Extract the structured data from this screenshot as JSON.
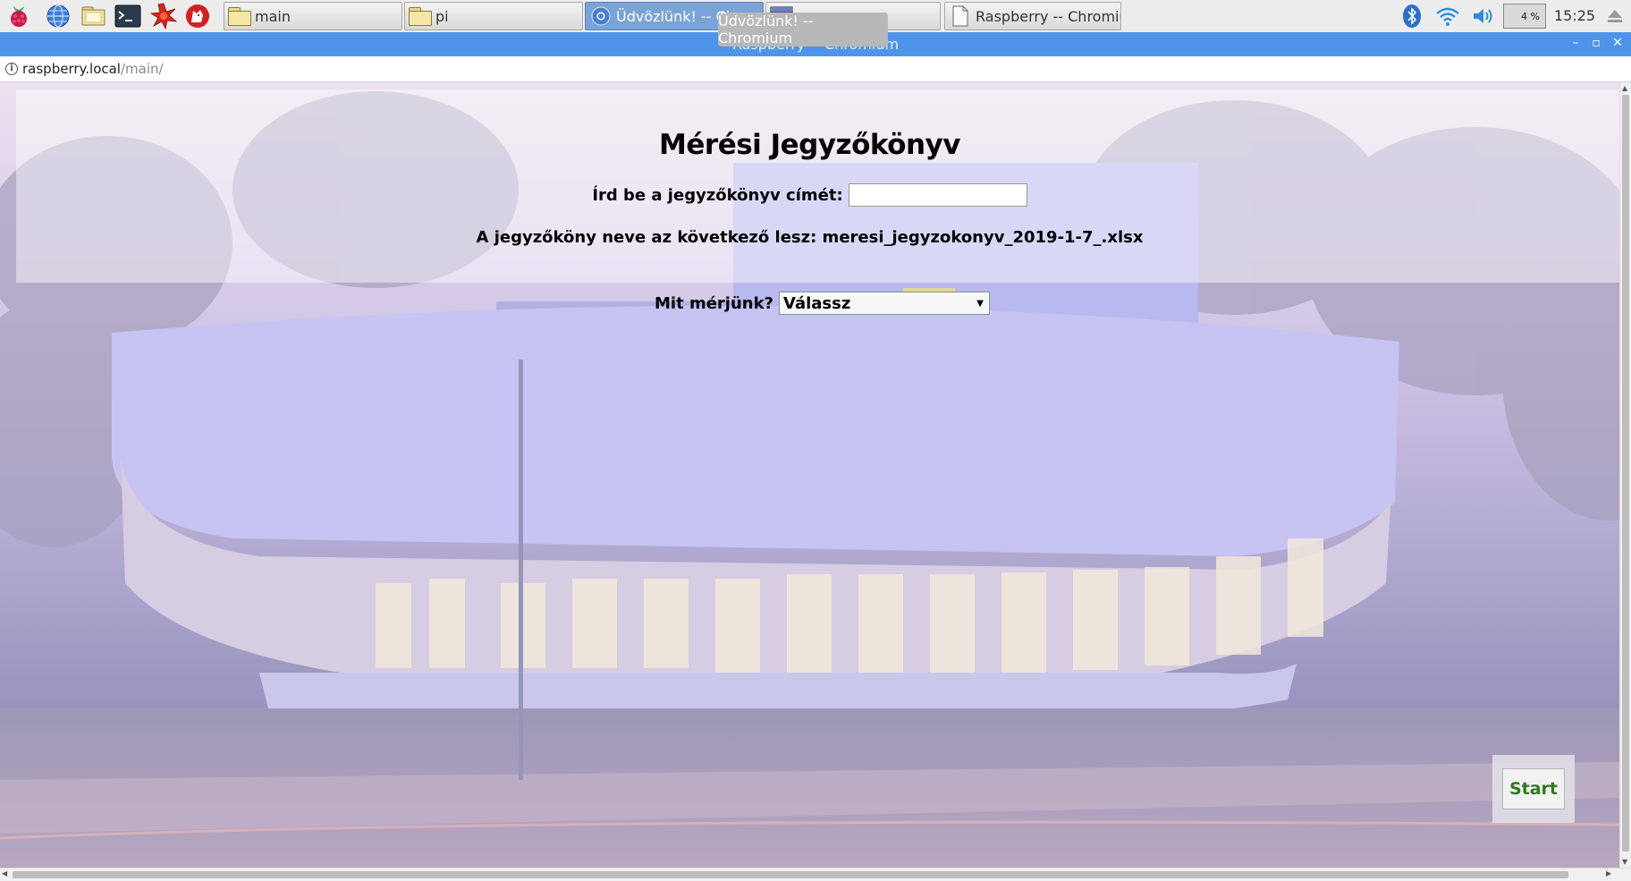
{
  "taskbar": {
    "launchers": [
      {
        "name": "raspberry-menu-icon"
      },
      {
        "name": "web-browser-icon"
      },
      {
        "name": "file-manager-icon"
      },
      {
        "name": "terminal-icon"
      },
      {
        "name": "math-kernel-icon"
      },
      {
        "name": "wolfram-icon"
      }
    ],
    "tasks": [
      {
        "label": "main",
        "icon": "folder-icon",
        "active": false
      },
      {
        "label": "pi",
        "icon": "folder-icon",
        "active": false
      },
      {
        "label": "Üdvözlünk! -- Ch",
        "icon": "chromium-icon",
        "active": true
      },
      {
        "label": "",
        "icon": "window-icon",
        "active": false
      },
      {
        "label": "Raspberry -- Chromiu...",
        "icon": "document-icon",
        "active": false
      }
    ],
    "tooltip": "Üdvözlünk! -- Chromium",
    "cpu": "4 %",
    "clock": "15:25"
  },
  "window": {
    "title": "Raspberry -- Chromium",
    "minimize": "–",
    "restore": "▫",
    "close": "✕"
  },
  "address": {
    "host": "raspberry.local",
    "path": "/main/"
  },
  "page": {
    "title": "Mérési Jegyzőkönyv",
    "title_input_label": "Írd be a jegyzőkönyv címét:",
    "title_input_value": "",
    "filename_text": "A jegyzőköny neve az következő lesz: meresi_jegyzokonyv_2019-1-7_.xlsx",
    "measure_label": "Mit mérjünk?",
    "measure_selected": "Válassz",
    "start_label": "Start"
  },
  "colors": {
    "titlebar": "#4d94ea",
    "start_text": "#2d7a1f"
  }
}
